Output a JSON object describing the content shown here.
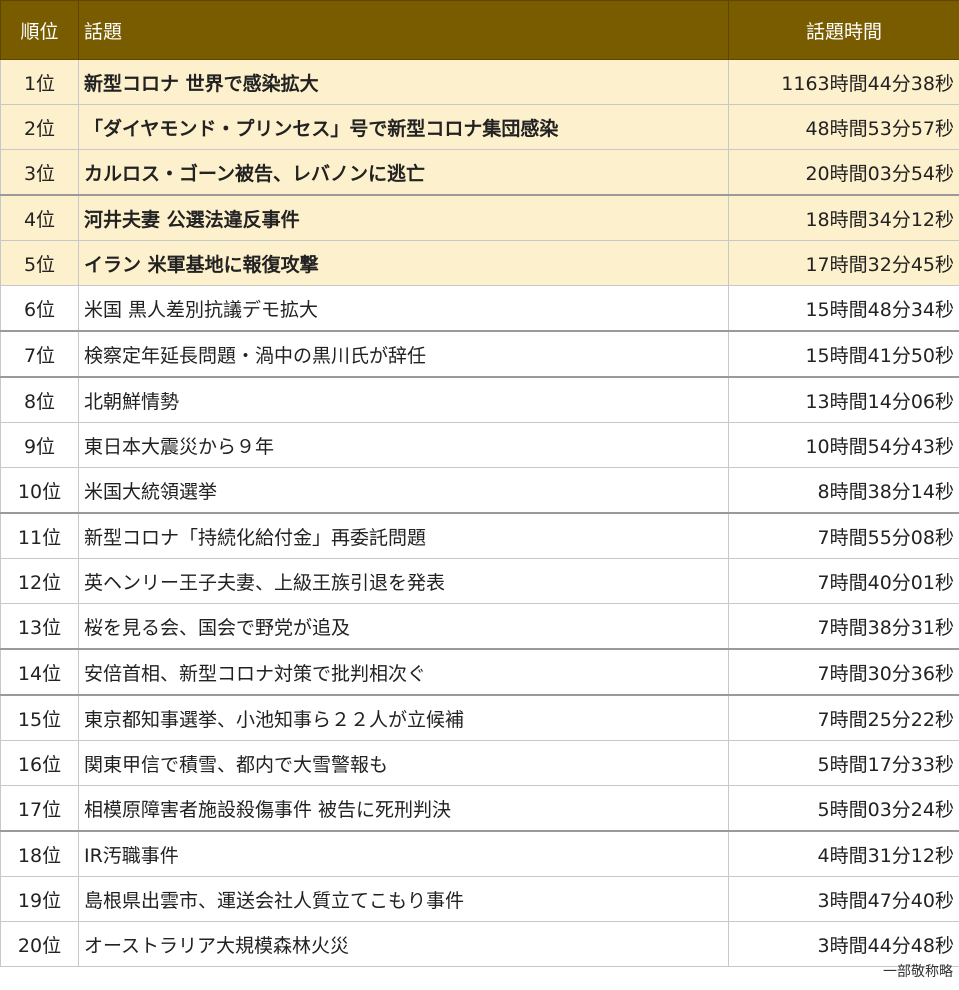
{
  "table": {
    "headers": {
      "rank": "順位",
      "topic": "話題",
      "time": "話題時間"
    },
    "rows": [
      {
        "rank": "1位",
        "topic": "新型コロナ 世界で感染拡大",
        "time": "1163時間44分38秒"
      },
      {
        "rank": "2位",
        "topic": "「ダイヤモンド・プリンセス」号で新型コロナ集団感染",
        "time": "48時間53分57秒"
      },
      {
        "rank": "3位",
        "topic": "カルロス・ゴーン被告、レバノンに逃亡",
        "time": "20時間03分54秒"
      },
      {
        "rank": "4位",
        "topic": "河井夫妻 公選法違反事件",
        "time": "18時間34分12秒"
      },
      {
        "rank": "5位",
        "topic": "イラン 米軍基地に報復攻撃",
        "time": "17時間32分45秒"
      },
      {
        "rank": "6位",
        "topic": "米国 黒人差別抗議デモ拡大",
        "time": "15時間48分34秒"
      },
      {
        "rank": "7位",
        "topic": "検察定年延長問題・渦中の黒川氏が辞任",
        "time": "15時間41分50秒"
      },
      {
        "rank": "8位",
        "topic": "北朝鮮情勢",
        "time": "13時間14分06秒"
      },
      {
        "rank": "9位",
        "topic": "東日本大震災から９年",
        "time": "10時間54分43秒"
      },
      {
        "rank": "10位",
        "topic": "米国大統領選挙",
        "time": "8時間38分14秒"
      },
      {
        "rank": "11位",
        "topic": "新型コロナ「持続化給付金」再委託問題",
        "time": "7時間55分08秒"
      },
      {
        "rank": "12位",
        "topic": "英ヘンリー王子夫妻、上級王族引退を発表",
        "time": "7時間40分01秒"
      },
      {
        "rank": "13位",
        "topic": "桜を見る会、国会で野党が追及",
        "time": "7時間38分31秒"
      },
      {
        "rank": "14位",
        "topic": "安倍首相、新型コロナ対策で批判相次ぐ",
        "time": "7時間30分36秒"
      },
      {
        "rank": "15位",
        "topic": "東京都知事選挙、小池知事ら２２人が立候補",
        "time": "7時間25分22秒"
      },
      {
        "rank": "16位",
        "topic": "関東甲信で積雪、都内で大雪警報も",
        "time": "5時間17分33秒"
      },
      {
        "rank": "17位",
        "topic": "相模原障害者施設殺傷事件 被告に死刑判決",
        "time": "5時間03分24秒"
      },
      {
        "rank": "18位",
        "topic": "IR汚職事件",
        "time": "4時間31分12秒"
      },
      {
        "rank": "19位",
        "topic": "島根県出雲市、運送会社人質立てこもり事件",
        "time": "3時間47分40秒"
      },
      {
        "rank": "20位",
        "topic": "オーストラリア大規模森林火災",
        "time": "3時間44分48秒"
      }
    ]
  },
  "footnote": "一部敬称略",
  "colors": {
    "header_bg": "#7a5c00",
    "highlight_bg": "#fdf0cc"
  }
}
